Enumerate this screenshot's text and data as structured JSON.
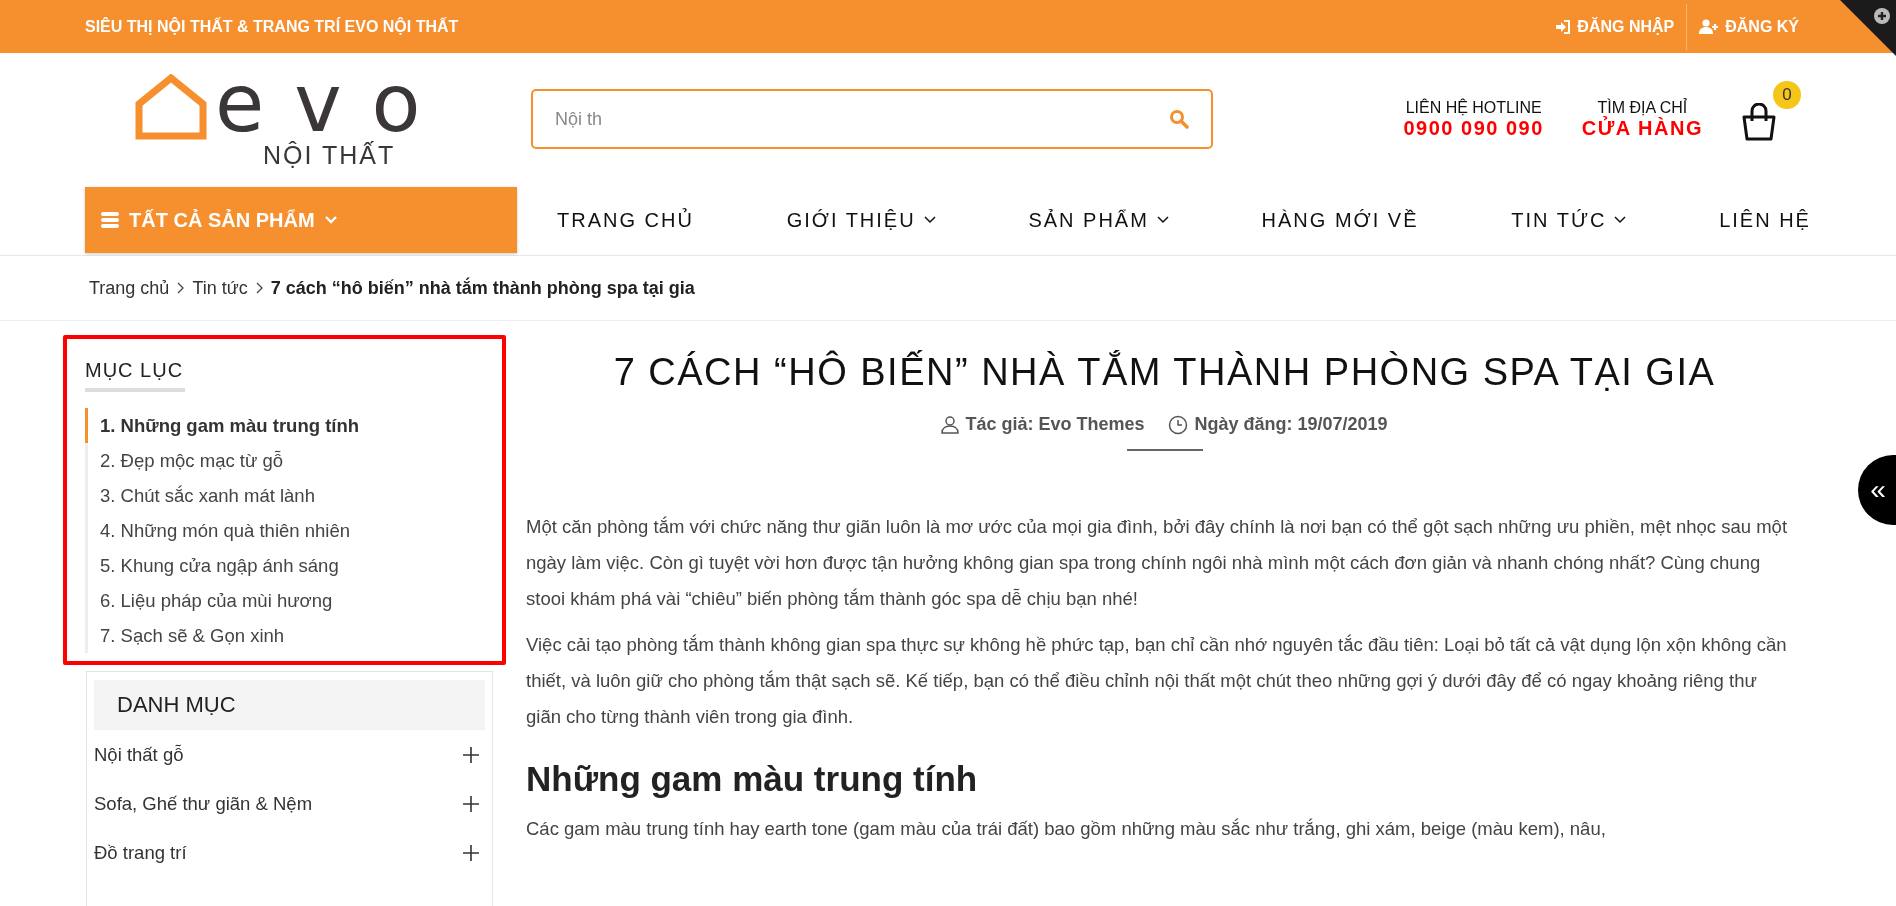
{
  "top_bar": {
    "title": "SIÊU THỊ NỘI THẤT & TRANG TRÍ EVO NỘI THẤT",
    "links": [
      {
        "kind": "login",
        "label": "ĐĂNG NHẬP"
      },
      {
        "kind": "register",
        "label": "ĐĂNG KÝ"
      }
    ]
  },
  "logo": {
    "mark": "evo",
    "tagline": "NỘI THẤT"
  },
  "search": {
    "placeholder": "Nội th"
  },
  "contacts": [
    {
      "label": "LIÊN HỆ HOTLINE",
      "value": "0900 090 090"
    },
    {
      "label": "TÌM ĐỊA CHỈ",
      "value": "CỬA HÀNG"
    }
  ],
  "cart": {
    "count": "0"
  },
  "nav": {
    "all_products": "TẤT CẢ SẢN PHẨM",
    "items": [
      {
        "label": "TRANG CHỦ",
        "dropdown": false
      },
      {
        "label": "GIỚI THIỆU",
        "dropdown": true
      },
      {
        "label": "SẢN PHẨM",
        "dropdown": true
      },
      {
        "label": "HÀNG MỚI VỀ",
        "dropdown": false
      },
      {
        "label": "TIN TỨC",
        "dropdown": true
      },
      {
        "label": "LIÊN HỆ",
        "dropdown": false
      }
    ]
  },
  "breadcrumb": [
    {
      "label": "Trang chủ",
      "current": false
    },
    {
      "label": "Tin tức",
      "current": false
    },
    {
      "label": "7 cách “hô biến” nhà tắm thành phòng spa tại gia",
      "current": true
    }
  ],
  "toc": {
    "title": "MỤC LỤC",
    "items": [
      {
        "label": "1. Những gam màu trung tính",
        "selected": true
      },
      {
        "label": "2. Đẹp mộc mạc từ gỗ",
        "selected": false
      },
      {
        "label": "3. Chút sắc xanh mát lành",
        "selected": false
      },
      {
        "label": "4. Những món quà thiên nhiên",
        "selected": false
      },
      {
        "label": "5. Khung cửa ngập ánh sáng",
        "selected": false
      },
      {
        "label": "6. Liệu pháp của mùi hương",
        "selected": false
      },
      {
        "label": "7. Sạch sẽ & Gọn xinh",
        "selected": false
      }
    ]
  },
  "categories": {
    "title": "DANH MỤC",
    "items": [
      "Nội thất gỗ",
      "Sofa, Ghế thư giãn & Nệm",
      "Đồ trang trí"
    ]
  },
  "article": {
    "title": "7 CÁCH “HÔ BIẾN” NHÀ TẮM THÀNH PHÒNG SPA TẠI GIA",
    "author": "Tác giả: Evo Themes",
    "date": "Ngày đăng: 19/07/2019",
    "blocks": [
      {
        "kind": "p",
        "text": "Một căn phòng tắm với chức năng thư giãn luôn là mơ ước của mọi gia đình, bởi đây chính là nơi bạn có thể gột sạch những ưu phiền, mệt nhọc sau một ngày làm việc. Còn gì tuyệt vời hơn được tận hưởng không gian spa trong chính ngôi nhà mình một cách đơn giản và nhanh chóng nhất? Cùng chung stooi khám phá vài “chiêu” biến phòng tắm thành góc spa dễ chịu bạn nhé!"
      },
      {
        "kind": "p",
        "text": "Việc cải tạo phòng tắm thành không gian spa thực sự không hề phức tạp, bạn chỉ cần nhớ nguyên tắc đầu tiên: Loại bỏ tất cả vật dụng lộn xộn không cần thiết, và luôn giữ cho phòng tắm thật sạch sẽ. Kế tiếp, bạn có thể điều chỉnh nội thất một chút theo những gợi ý dưới đây để có ngay khoảng riêng thư giãn cho từng thành viên trong gia đình."
      },
      {
        "kind": "h2",
        "text": "Những gam màu trung tính"
      },
      {
        "kind": "p",
        "text": "Các gam màu trung tính hay earth tone (gam màu của trái đất) bao gồm những màu sắc như trắng, ghi xám, beige (màu kem), nâu,"
      }
    ]
  },
  "side_toggle": "«"
}
